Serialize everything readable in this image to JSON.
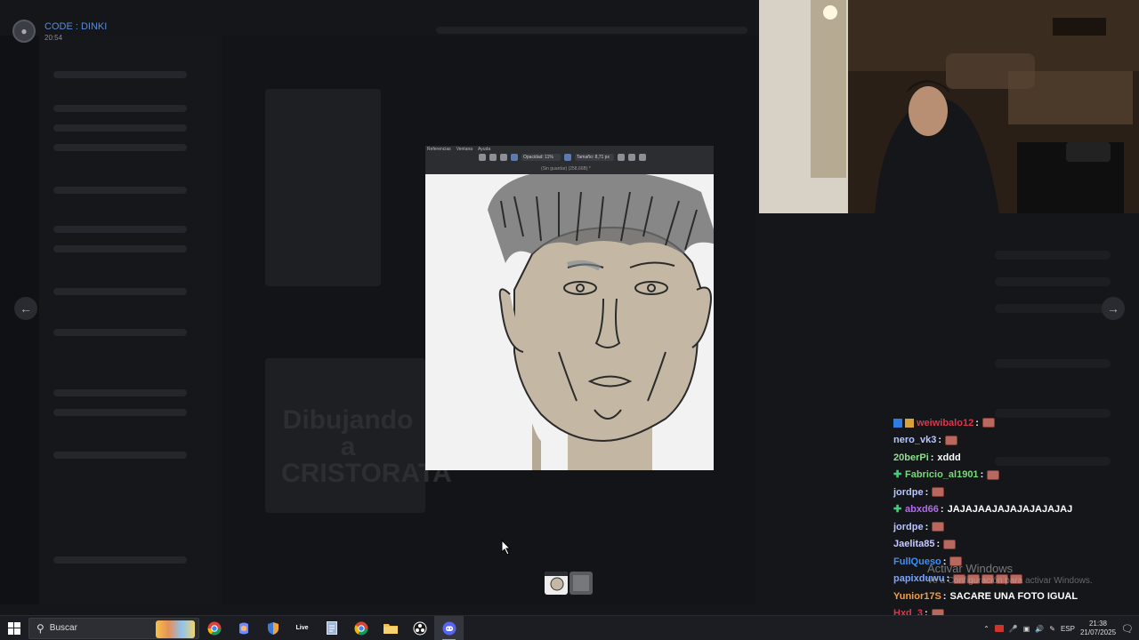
{
  "viewer": {
    "title": "CODE : DINKI",
    "time": "20:54"
  },
  "background": {
    "ghost_title": "Dibujando a CRISTORATA"
  },
  "paint_app": {
    "menu": [
      "Referencias",
      "Ventana",
      "Ayuda"
    ],
    "opacity_label": "Opacidad: 11%",
    "size_label": "Tamaño: 8,71 px",
    "status": "(Sin guardar) (258,66B) *"
  },
  "chat": [
    {
      "user": "weiwibalo12",
      "user_color": "#e0344a",
      "badges": [
        "blue",
        "gold"
      ],
      "message": "",
      "emotes": 1
    },
    {
      "user": "nero_vk3",
      "user_color": "#b9c5ff",
      "badges": [],
      "message": "",
      "emotes": 1
    },
    {
      "user": "20berPi",
      "user_color": "#8ee08e",
      "badges": [],
      "message": "xddd",
      "emotes": 0
    },
    {
      "user": "Fabricio_al1901",
      "user_color": "#7ad77a",
      "badges": [
        "plus"
      ],
      "message": "",
      "emotes": 1
    },
    {
      "user": "jordpe",
      "user_color": "#b9c5ff",
      "badges": [],
      "message": "",
      "emotes": 1
    },
    {
      "user": "abxd66",
      "user_color": "#b46af0",
      "badges": [
        "plus"
      ],
      "message": "JAJAJAAJAJAJAJAJAJAJ",
      "emotes": 0
    },
    {
      "user": "jordpe",
      "user_color": "#b9c5ff",
      "badges": [],
      "message": "",
      "emotes": 1
    },
    {
      "user": "Jaelita85",
      "user_color": "#c7c9ff",
      "badges": [],
      "message": "",
      "emotes": 1
    },
    {
      "user": "FullQueso",
      "user_color": "#3f8ef0",
      "badges": [],
      "message": "",
      "emotes": 1
    },
    {
      "user": "papixduwu",
      "user_color": "#7da3ff",
      "badges": [],
      "message": "",
      "emotes": 5
    },
    {
      "user": "Yunior17S",
      "user_color": "#f0a040",
      "badges": [],
      "message": "SACARE UNA FOTO IGUAL",
      "emotes": 0
    },
    {
      "user": "Hxd_3",
      "user_color": "#e0344a",
      "badges": [],
      "message": "",
      "emotes": 1
    }
  ],
  "watermark": {
    "title": "Activar Windows",
    "subtitle": "Ve a Configuración para activar Windows."
  },
  "taskbar": {
    "search_placeholder": "Buscar",
    "apps": [
      "chrome-icon",
      "copilot-icon",
      "shield-app-icon",
      "live-icon",
      "notepad-icon",
      "chrome-alt-icon",
      "folder-icon",
      "obs-icon",
      "discord-icon"
    ],
    "live_label": "Live",
    "language": "ESP",
    "time": "21:38",
    "date": "21/07/2025"
  },
  "colors": {
    "accent": "#5865f2",
    "taskbar": "#1c1d22",
    "chat_text": "#ffffff"
  }
}
